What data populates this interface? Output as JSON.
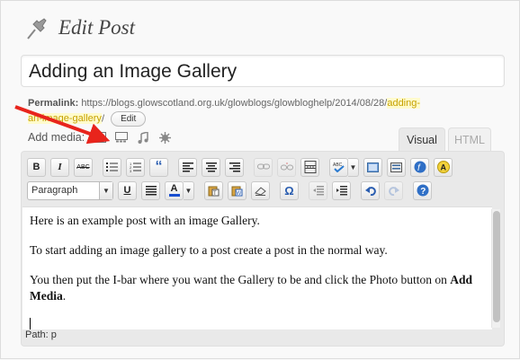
{
  "header": {
    "title": "Edit Post",
    "icon": "pushpin-icon"
  },
  "post_title": {
    "value": "Adding an Image Gallery"
  },
  "permalink": {
    "label": "Permalink:",
    "base": "https://blogs.glowscotland.org.uk/glowblogs/glowbloghelp/2014/08/28/",
    "slug_part1": "adding-",
    "slug_part2": "an-image-gallery",
    "trailing": "/",
    "edit_label": "Edit"
  },
  "add_media": {
    "label": "Add media:",
    "icons": [
      "image-icon",
      "gallery-icon",
      "audio-icon",
      "media-icon"
    ]
  },
  "tabs": {
    "visual": "Visual",
    "html": "HTML"
  },
  "toolbar": {
    "row1": [
      "bold-icon",
      "italic-icon",
      "strikethrough-icon",
      "bullet-list-icon",
      "numbered-list-icon",
      "blockquote-icon",
      "align-left-icon",
      "align-center-icon",
      "align-right-icon",
      "link-icon",
      "unlink-icon",
      "more-tag-icon",
      "spellcheck-icon",
      "fullscreen-icon",
      "kitchen-sink-icon",
      "flash-icon",
      "a-icon"
    ],
    "format_value": "Paragraph",
    "underline_label": "U",
    "bold_label": "B",
    "italic_label": "I",
    "strike_label": "ABC",
    "textcolor_label": "A",
    "omega_label": "Ω",
    "help_label": "?"
  },
  "content": {
    "p1": "Here is an example post with an image Gallery.",
    "p2": "To start adding an image gallery to a post create a post in the normal way.",
    "p3_a": "You then put the I-bar where you want the Gallery to be and click the Photo button  on ",
    "p3_b": "Add Media",
    "p3_c": "."
  },
  "status": {
    "path": "Path: p"
  },
  "colors": {
    "arrow": "#e8241c",
    "slug_highlight": "#fffbcc",
    "text_color_bar": "#1a4fd0"
  }
}
